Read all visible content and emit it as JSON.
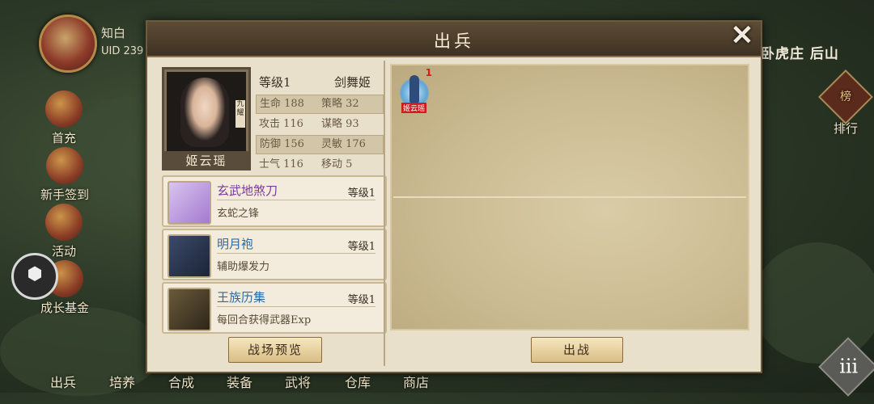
{
  "hud": {
    "player_name": "知白",
    "uid": "UID 239",
    "location": "卧虎庄  后山",
    "left_buttons": [
      "首充",
      "新手签到",
      "活动",
      "成长基金"
    ],
    "rank_icon": "榜",
    "rank_label": "排行",
    "cube_icon": "cube-icon",
    "bottom_tabs": [
      "出兵",
      "培养",
      "合成",
      "装备",
      "武将",
      "仓库",
      "商店"
    ],
    "menu_icon": "iii"
  },
  "dialog": {
    "title": "出兵",
    "close_icon": "✕",
    "hero": {
      "name": "姬云瑶",
      "portrait_tag": "九耀",
      "level_label": "等级1",
      "class_name": "剑舞姬",
      "stats": [
        [
          "生命 188",
          "策略 32"
        ],
        [
          "攻击 116",
          "谋略 93"
        ],
        [
          "防御 156",
          "灵敏 176"
        ],
        [
          "士气 116",
          "移动 5"
        ]
      ]
    },
    "equipment": [
      {
        "name": "玄武地煞刀",
        "level": "等级1",
        "desc": "玄蛇之锋",
        "name_color": "#7a3a9a"
      },
      {
        "name": "明月袍",
        "level": "等级1",
        "desc": "辅助爆发力",
        "name_color": "#2a6aa8"
      },
      {
        "name": "王族历集",
        "level": "等级1",
        "desc": "每回合获得武器Exp",
        "name_color": "#2a6aa8"
      }
    ],
    "preview_button": "战场预览",
    "deploy_button": "出战",
    "unit": {
      "name": "姬云瑶",
      "count": "1"
    }
  }
}
